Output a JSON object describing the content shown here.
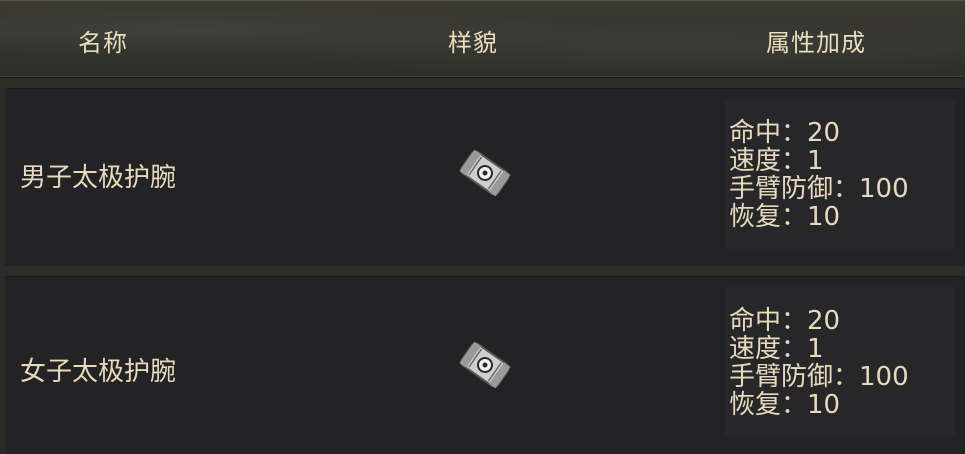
{
  "header": {
    "col_name": "名称",
    "col_look": "样貌",
    "col_attr": "属性加成"
  },
  "rows": [
    {
      "name": "男子太极护腕",
      "icon": "bracer-icon",
      "attrs": [
        "命中：20",
        "速度：1",
        "手臂防御：100",
        "恢复：10"
      ]
    },
    {
      "name": "女子太极护腕",
      "icon": "bracer-icon",
      "attrs": [
        "命中：20",
        "速度：1",
        "手臂防御：100",
        "恢复：10"
      ]
    }
  ],
  "colors": {
    "text": "#e6d9bc",
    "row_bg": "#232325",
    "header_bg": "#35342e"
  }
}
